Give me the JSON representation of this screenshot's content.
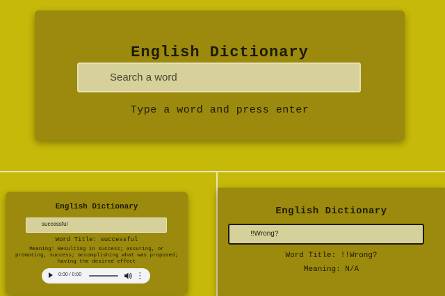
{
  "colors": {
    "background": "#c6b90a",
    "card": "#9b8a0d",
    "input": "#d6d09a",
    "text": "#1e1a05"
  },
  "panel_empty": {
    "title": "English Dictionary",
    "search_placeholder": "Search a word",
    "hint": "Type a word and press enter"
  },
  "panel_success": {
    "title": "English Dictionary",
    "search_value": "successful",
    "word_title": "Word Title: successful",
    "meaning": "Meaning: Resulting in success; assuring, or promoting, success; accomplishing what was proposed; having the desired effect",
    "audio_time": "0:00 / 0:00"
  },
  "panel_error": {
    "title": "English Dictionary",
    "search_value": "!!Wrong?",
    "word_title": "Word Title: !!Wrong?",
    "meaning": "Meaning: N/A"
  }
}
